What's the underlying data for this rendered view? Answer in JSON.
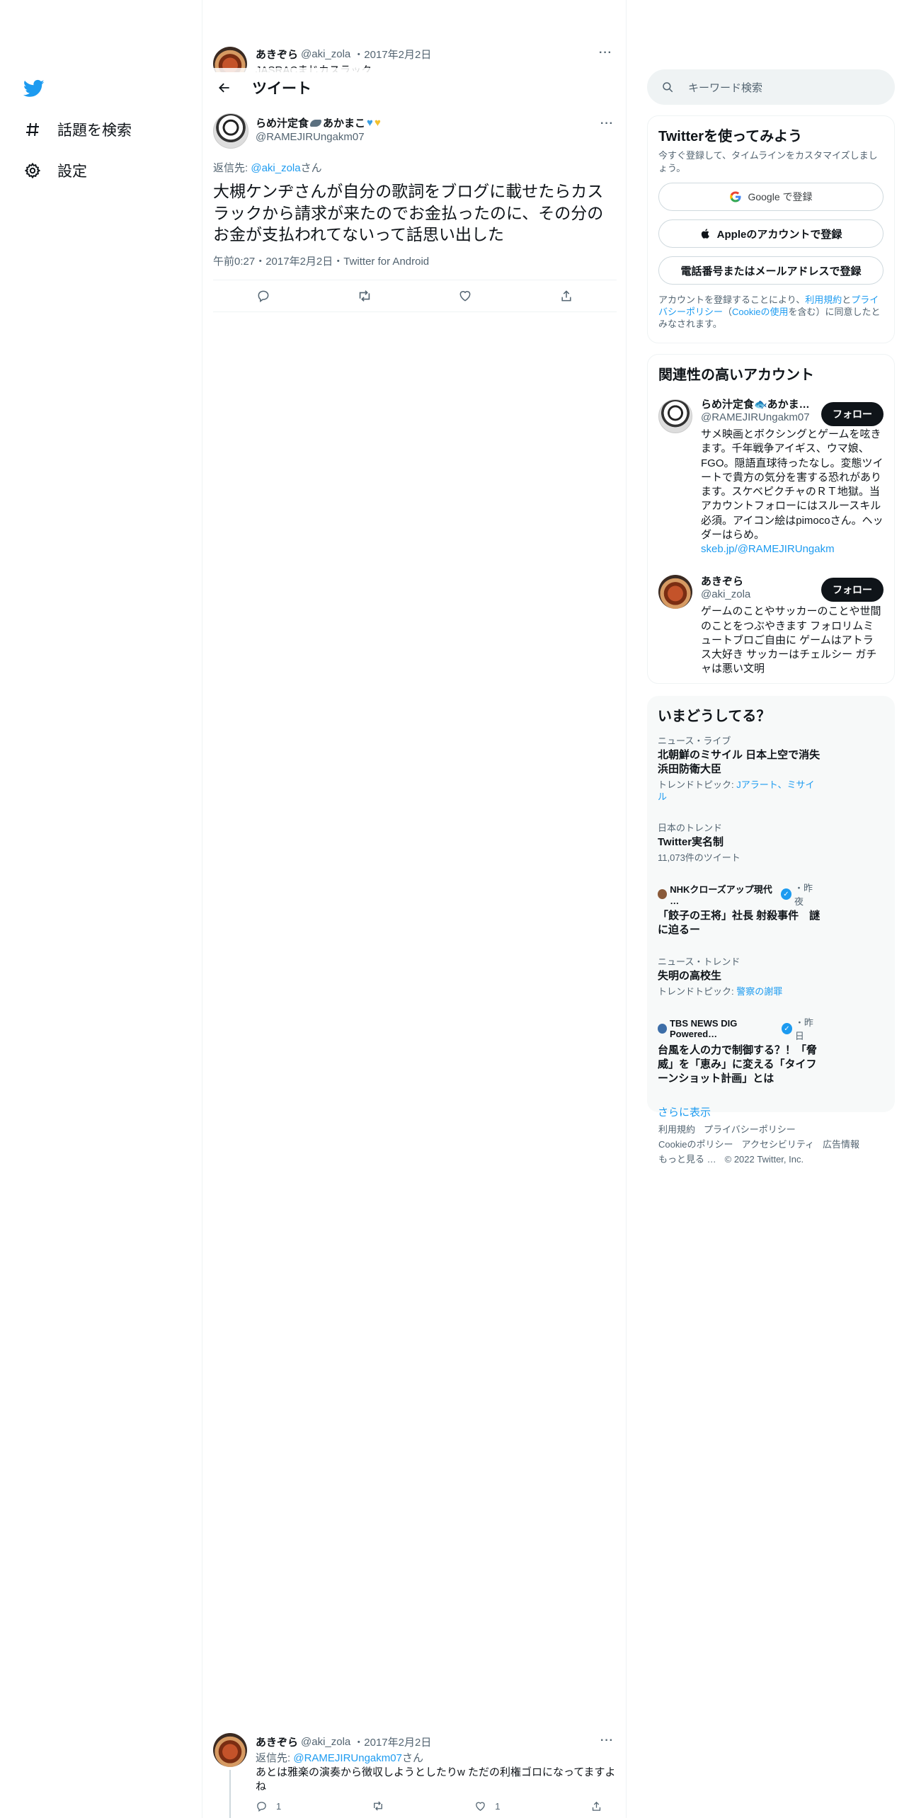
{
  "nav": {
    "logo": "twitter-bird",
    "items": [
      {
        "label": "話題を検索",
        "icon": "hashtag-icon"
      },
      {
        "label": "設定",
        "icon": "gear-icon"
      }
    ]
  },
  "behind_tweet": {
    "name": "あきぞら",
    "handle": "@aki_zola",
    "date": "・2017年2月2日",
    "text": "JASRACまじカスラック"
  },
  "header": {
    "title": "ツイート"
  },
  "tweet": {
    "name": "らめ汁定食",
    "name_suffix": "あかまこ",
    "handle": "@RAMEJIRUngakm07",
    "reply_prefix": "返信先: ",
    "reply_to": "@aki_zola",
    "reply_suffix": "さん",
    "text": "大槻ケンヂさんが自分の歌詞をブログに載せたらカスラックから請求が来たのでお金払ったのに、その分のお金が支払われてないって話思い出した",
    "meta": "午前0:27・2017年2月2日・Twitter for Android"
  },
  "reply": {
    "name": "あきぞら",
    "handle": "@aki_zola",
    "date": "・2017年2月2日",
    "reply_prefix": "返信先: ",
    "reply_to": "@RAMEJIRUngakm07",
    "reply_suffix": "さん",
    "text": "あとは雅楽の演奏から徴収しようとしたりw ただの利権ゴロになってますよね",
    "reply_count": "1",
    "like_count": "1"
  },
  "sidebar": {
    "search_placeholder": "キーワード検索",
    "signup": {
      "title": "Twitterを使ってみよう",
      "subtitle": "今すぐ登録して、タイムラインをカスタマイズしましょう。",
      "google": "Google で登録",
      "apple": "Appleのアカウントで登録",
      "phone": "電話番号またはメールアドレスで登録",
      "legal_1": "アカウントを登録することにより、",
      "legal_terms": "利用規約",
      "legal_2": "と",
      "legal_privacy": "プライバシーポリシー",
      "legal_3": "（",
      "legal_cookie": "Cookieの使用",
      "legal_4": "を含む）に同意したとみなされます。"
    },
    "relevant": {
      "title": "関連性の高いアカウント",
      "accounts": [
        {
          "name": "らめ汁定食🐟あかま…",
          "handle": "@RAMEJIRUngakm07",
          "bio": "サメ映画とボクシングとゲームを呟きます。千年戦争アイギス、ウマ娘、FGO。隠語直球待ったなし。変態ツイートで貴方の気分を害する恐れがあります。スケベピクチャのＲＴ地獄。当アカウントフォローにはスルースキル必須。アイコン絵はpimocoさん。ヘッダーはらめ。",
          "link": "skeb.jp/@RAMEJIRUngakm",
          "follow": "フォロー"
        },
        {
          "name": "あきぞら",
          "handle": "@aki_zola",
          "bio": "ゲームのことやサッカーのことや世間のことをつぶやきます フォロリムミュートブロご自由に ゲームはアトラス大好き サッカーはチェルシー ガチャは悪い文明",
          "link": "",
          "follow": "フォロー"
        }
      ]
    },
    "trends": {
      "title": "いまどうしてる？",
      "items": [
        {
          "context": "ニュース・ライブ",
          "title": "北朝鮮のミサイル 日本上空で消失 浜田防衛大臣",
          "sub_prefix": "トレンドトピック: ",
          "sub_link": "Jアラート、ミサイル"
        },
        {
          "context": "日本のトレンド",
          "title": "Twitter実名制",
          "sub_prefix": "11,073件のツイート",
          "sub_link": ""
        },
        {
          "context": "NHKクローズアップ現代 …",
          "context_suffix": "・昨夜",
          "title": "「餃子の王将」社長 射殺事件　謎に迫るー",
          "sub_prefix": "",
          "sub_link": ""
        },
        {
          "context": "ニュース・トレンド",
          "title": "失明の高校生",
          "sub_prefix": "トレンドトピック: ",
          "sub_link": "警察の謝罪"
        },
        {
          "context": "TBS NEWS DIG Powered…",
          "context_suffix": "・昨日",
          "title": "台風を人の力で制御する？！「脅威」を「恵み」に変える「タイフーンショット計画」とは",
          "sub_prefix": "",
          "sub_link": ""
        }
      ],
      "show_more": "さらに表示"
    },
    "footer": {
      "terms": "利用規約",
      "privacy": "プライバシーポリシー",
      "cookie": "Cookieのポリシー",
      "accessibility": "アクセシビリティ",
      "ads": "広告情報",
      "more": "もっと見る …",
      "copyright": "© 2022 Twitter, Inc."
    }
  }
}
